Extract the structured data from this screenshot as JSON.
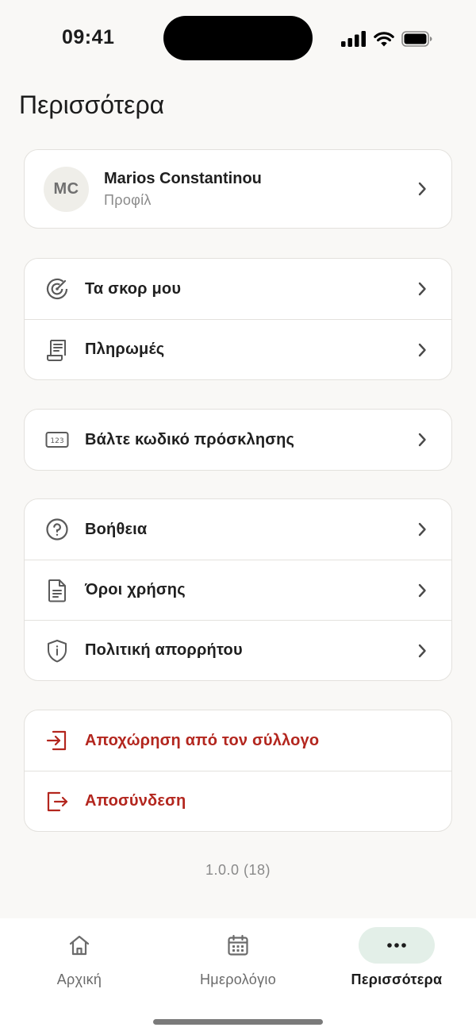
{
  "status": {
    "time": "09:41"
  },
  "page": {
    "title": "Περισσότερα"
  },
  "profile": {
    "initials": "MC",
    "name": "Marios Constantinou",
    "subtitle": "Προφίλ"
  },
  "groups": [
    {
      "items": [
        {
          "label": "Τα σκορ μου",
          "icon": "target-icon"
        },
        {
          "label": "Πληρωμές",
          "icon": "receipt-icon"
        }
      ]
    },
    {
      "items": [
        {
          "label": "Βάλτε κωδικό πρόσκλησης",
          "icon": "numeric-code-icon"
        }
      ]
    },
    {
      "items": [
        {
          "label": "Βοήθεια",
          "icon": "help-circle-icon"
        },
        {
          "label": "Όροι χρήσης",
          "icon": "document-icon"
        },
        {
          "label": "Πολιτική απορρήτου",
          "icon": "shield-icon"
        }
      ]
    },
    {
      "items": [
        {
          "label": "Αποχώρηση από τον σύλλογο",
          "icon": "leave-club-icon"
        },
        {
          "label": "Αποσύνδεση",
          "icon": "logout-icon"
        }
      ]
    }
  ],
  "version": "1.0.0 (18)",
  "tabs": [
    {
      "label": "Αρχική",
      "icon": "home-icon"
    },
    {
      "label": "Ημερολόγιο",
      "icon": "calendar-icon"
    },
    {
      "label": "Περισσότερα",
      "icon": "more-dots-icon"
    }
  ],
  "colors": {
    "danger": "#b3261e",
    "active_tab_bg": "#e3efe8",
    "background": "#f9f8f6"
  }
}
